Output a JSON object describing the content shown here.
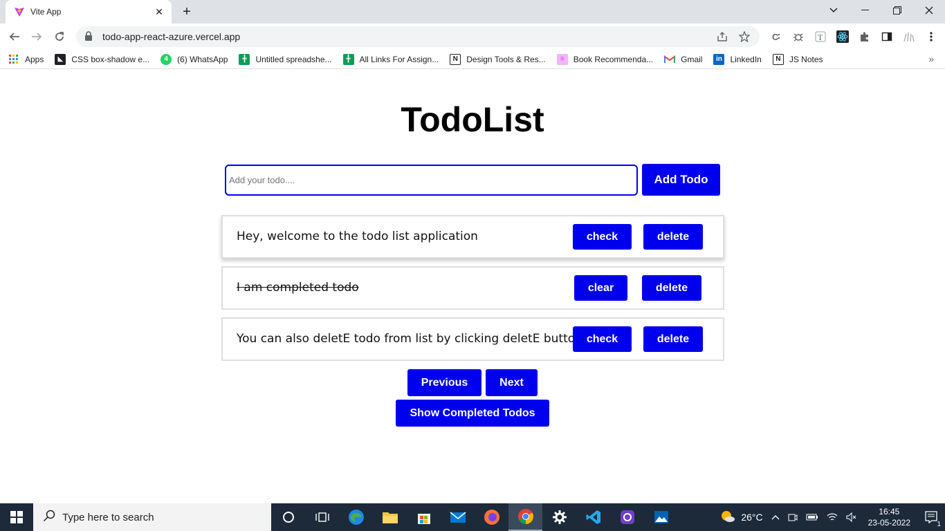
{
  "browser": {
    "tab_title": "Vite App",
    "tab_close": "✕",
    "new_tab": "+",
    "url": "todo-app-react-azure.vercel.app",
    "bookmarks": [
      {
        "label": "Apps",
        "icon": "apps-grid-icon",
        "color": "#ea4335"
      },
      {
        "label": "CSS box-shadow e...",
        "icon": "bookmark-page-icon",
        "color": "#202124"
      },
      {
        "label": "(6) WhatsApp",
        "icon": "whatsapp-icon",
        "color": "#25d366"
      },
      {
        "label": "Untitled spreadshe...",
        "icon": "sheets-icon",
        "color": "#0f9d58"
      },
      {
        "label": "All Links For Assign...",
        "icon": "sheets-icon",
        "color": "#0f9d58"
      },
      {
        "label": "Design Tools & Res...",
        "icon": "notion-icon",
        "color": "#202124"
      },
      {
        "label": "Book Recommenda...",
        "icon": "book-icon",
        "color": "#e040fb"
      },
      {
        "label": "Gmail",
        "icon": "gmail-icon",
        "color": "#ea4335"
      },
      {
        "label": "LinkedIn",
        "icon": "linkedin-icon",
        "color": "#0a66c2"
      },
      {
        "label": "JS Notes",
        "icon": "notion-icon",
        "color": "#202124"
      }
    ],
    "bookmarks_more": "»"
  },
  "app": {
    "title": "TodoList",
    "input_placeholder": "Add your todo....",
    "input_value": "",
    "add_button": "Add Todo",
    "todos": [
      {
        "text": "Hey, welcome to the todo list application",
        "completed": false,
        "action": "check",
        "delete": "delete"
      },
      {
        "text": "I am completed todo",
        "completed": true,
        "action": "clear",
        "delete": "delete"
      },
      {
        "text": "You can also deletE todo from list by clicking deletE button",
        "completed": false,
        "action": "check",
        "delete": "delete"
      }
    ],
    "previous_button": "Previous",
    "next_button": "Next",
    "show_completed_button": "Show Completed Todos"
  },
  "colors": {
    "accent": "#0000ee",
    "input_border": "#0000e6"
  },
  "taskbar": {
    "search_placeholder": "Type here to search",
    "temperature": "26°C",
    "time": "16:45",
    "date": "23-05-2022",
    "notification_count": "1"
  }
}
